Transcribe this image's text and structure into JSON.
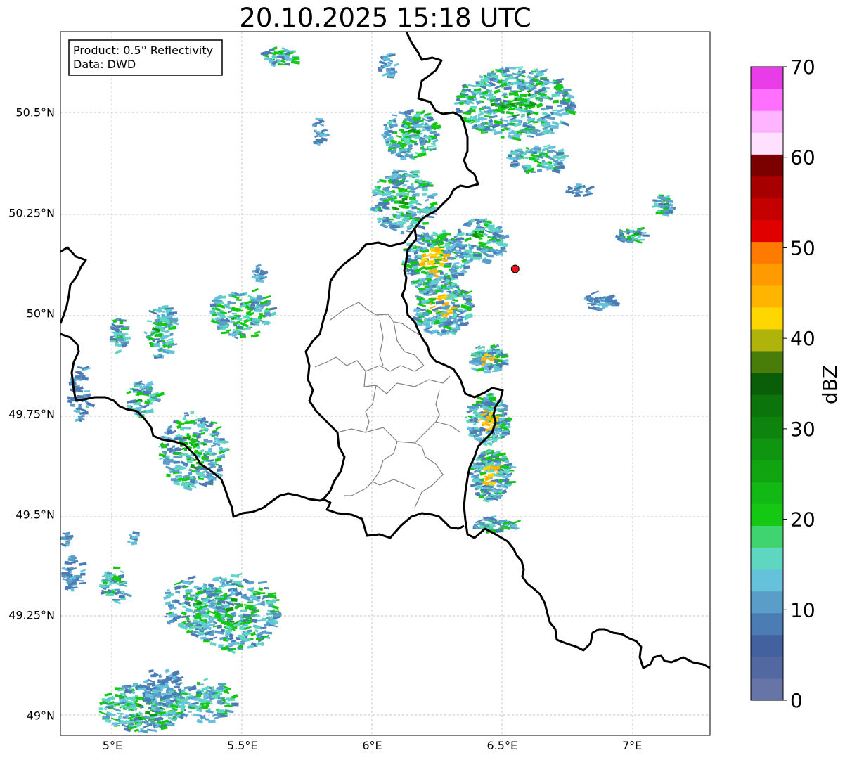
{
  "title": "20.10.2025 15:18 UTC",
  "info_box": {
    "line1": "Product: 0.5° Reflectivity",
    "line2": "Data: DWD"
  },
  "map": {
    "lon_range": [
      4.8,
      7.3
    ],
    "lat_range": [
      48.95,
      50.7
    ],
    "lon_ticks": [
      {
        "value": 5.0,
        "label": "5°E"
      },
      {
        "value": 5.5,
        "label": "5.5°E"
      },
      {
        "value": 6.0,
        "label": "6°E"
      },
      {
        "value": 6.5,
        "label": "6.5°E"
      },
      {
        "value": 7.0,
        "label": "7°E"
      }
    ],
    "lat_ticks": [
      {
        "value": 49.0,
        "label": "49°N"
      },
      {
        "value": 49.25,
        "label": "49.25°N"
      },
      {
        "value": 49.5,
        "label": "49.5°N"
      },
      {
        "value": 49.75,
        "label": "49.75°N"
      },
      {
        "value": 50.0,
        "label": "50°N"
      },
      {
        "value": 50.25,
        "label": "50.25°N"
      },
      {
        "value": 50.5,
        "label": "50.5°N"
      }
    ],
    "grid": true,
    "radar_site": {
      "lon": 6.55,
      "lat": 50.11,
      "color": "#e8141a"
    }
  },
  "colorbar": {
    "label": "dBZ",
    "range": [
      0,
      70
    ],
    "ticks": [
      {
        "value": 0,
        "label": "0"
      },
      {
        "value": 10,
        "label": "10"
      },
      {
        "value": 20,
        "label": "20"
      },
      {
        "value": 30,
        "label": "30"
      },
      {
        "value": 40,
        "label": "40"
      },
      {
        "value": 50,
        "label": "50"
      },
      {
        "value": 60,
        "label": "60"
      },
      {
        "value": 70,
        "label": "70"
      }
    ],
    "colors": [
      "#6674a6",
      "#5367a0",
      "#43609f",
      "#4c7cb4",
      "#599dc8",
      "#66c2da",
      "#5fd6c0",
      "#3fd470",
      "#14c814",
      "#12b814",
      "#10a510",
      "#0f9510",
      "#0e840e",
      "#0b740b",
      "#0a5e0a",
      "#4a7c0a",
      "#b0b30a",
      "#ffd700",
      "#ffb400",
      "#ff9b00",
      "#ff7a00",
      "#e00000",
      "#c40000",
      "#a80000",
      "#7c0000",
      "#ffe0ff",
      "#ffb4ff",
      "#ff70ff",
      "#e83ce8"
    ]
  },
  "echo_colors": {
    "weak": "#4c7cb4",
    "light": "#599dc8",
    "cyan": "#66c2da",
    "teal": "#5fd6c0",
    "green": "#14c814",
    "dark_green": "#0f9510",
    "yellow": "#ffd700",
    "orange": "#ffb400",
    "red": "#e00000"
  }
}
